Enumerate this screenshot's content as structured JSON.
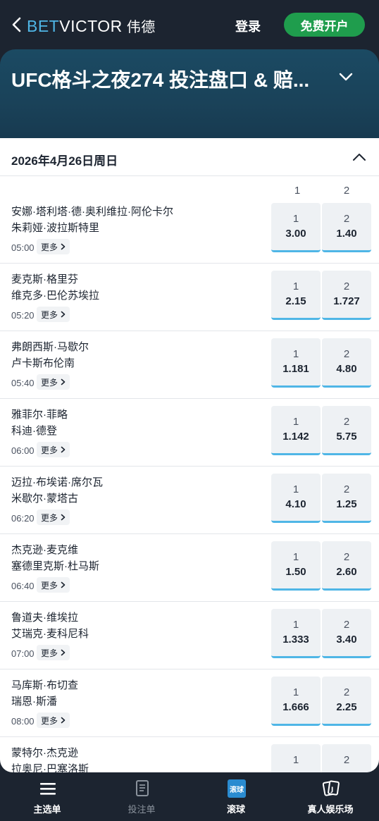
{
  "header": {
    "logo_bet": "BET",
    "logo_victor": "VICTOR",
    "logo_cn": "伟德",
    "login_label": "登录",
    "signup_label": "免费开户"
  },
  "hero": {
    "title": "UFC格斗之夜274 投注盘口 & 赔..."
  },
  "section": {
    "date": "2026年4月26日周日"
  },
  "columns": [
    "1",
    "2"
  ],
  "more_label": "更多",
  "matches": [
    {
      "fighter1": "安娜·塔利塔·德·奥利维拉·阿伦卡尔",
      "fighter2": "朱莉娅·波拉斯特里",
      "time": "05:00",
      "odd1_label": "1",
      "odd1": "3.00",
      "odd2_label": "2",
      "odd2": "1.40"
    },
    {
      "fighter1": "麦克斯·格里芬",
      "fighter2": "维克多·巴伦苏埃拉",
      "time": "05:20",
      "odd1_label": "1",
      "odd1": "2.15",
      "odd2_label": "2",
      "odd2": "1.727"
    },
    {
      "fighter1": "弗朗西斯·马歇尔",
      "fighter2": "卢卡斯布伦南",
      "time": "05:40",
      "odd1_label": "1",
      "odd1": "1.181",
      "odd2_label": "2",
      "odd2": "4.80"
    },
    {
      "fighter1": "雅菲尔·菲略",
      "fighter2": "科迪·德登",
      "time": "06:00",
      "odd1_label": "1",
      "odd1": "1.142",
      "odd2_label": "2",
      "odd2": "5.75"
    },
    {
      "fighter1": "迈拉·布埃诺·席尔瓦",
      "fighter2": "米歇尔·蒙塔古",
      "time": "06:20",
      "odd1_label": "1",
      "odd1": "4.10",
      "odd2_label": "2",
      "odd2": "1.25"
    },
    {
      "fighter1": "杰克逊·麦克维",
      "fighter2": "塞德里克斯·杜马斯",
      "time": "06:40",
      "odd1_label": "1",
      "odd1": "1.50",
      "odd2_label": "2",
      "odd2": "2.60"
    },
    {
      "fighter1": "鲁道夫·维埃拉",
      "fighter2": "艾瑞克·麦科尼科",
      "time": "07:00",
      "odd1_label": "1",
      "odd1": "1.333",
      "odd2_label": "2",
      "odd2": "3.40"
    },
    {
      "fighter1": "马库斯·布切查",
      "fighter2": "瑞恩·斯潘",
      "time": "08:00",
      "odd1_label": "1",
      "odd1": "1.666",
      "odd2_label": "2",
      "odd2": "2.25"
    },
    {
      "fighter1": "蒙特尔·杰克逊",
      "fighter2": "拉奥尼·巴塞洛斯",
      "time": "",
      "odd1_label": "1",
      "odd1": "",
      "odd2_label": "2",
      "odd2": ""
    }
  ],
  "bottom_nav": [
    {
      "label": "主选单",
      "icon": "menu-icon"
    },
    {
      "label": "投注单",
      "icon": "betslip-icon"
    },
    {
      "label": "滚球",
      "icon": "live-icon",
      "badge": "滚球"
    },
    {
      "label": "真人娱乐场",
      "icon": "cards-icon"
    }
  ],
  "colors": {
    "accent": "#4fb6e6",
    "signup": "#1f9d4d",
    "dark": "#1c2430"
  }
}
